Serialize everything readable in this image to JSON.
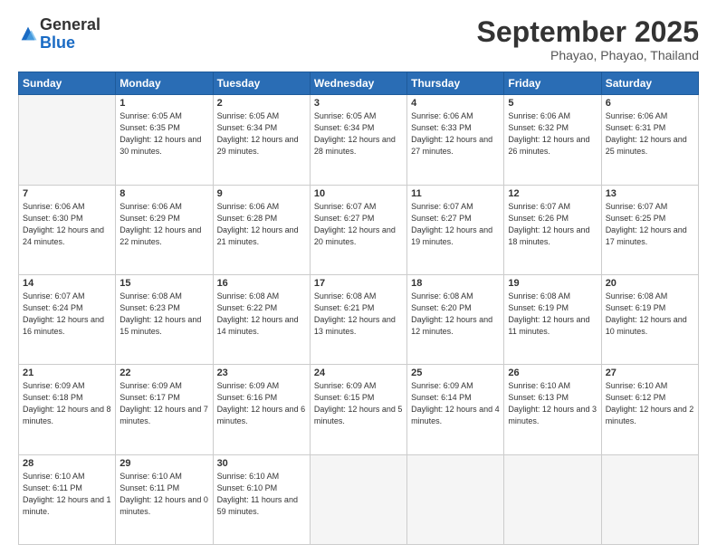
{
  "header": {
    "logo_general": "General",
    "logo_blue": "Blue",
    "month_title": "September 2025",
    "subtitle": "Phayao, Phayao, Thailand"
  },
  "days_of_week": [
    "Sunday",
    "Monday",
    "Tuesday",
    "Wednesday",
    "Thursday",
    "Friday",
    "Saturday"
  ],
  "weeks": [
    [
      {
        "day": "",
        "empty": true
      },
      {
        "day": "1",
        "sunrise": "6:05 AM",
        "sunset": "6:35 PM",
        "daylight": "12 hours and 30 minutes."
      },
      {
        "day": "2",
        "sunrise": "6:05 AM",
        "sunset": "6:34 PM",
        "daylight": "12 hours and 29 minutes."
      },
      {
        "day": "3",
        "sunrise": "6:05 AM",
        "sunset": "6:34 PM",
        "daylight": "12 hours and 28 minutes."
      },
      {
        "day": "4",
        "sunrise": "6:06 AM",
        "sunset": "6:33 PM",
        "daylight": "12 hours and 27 minutes."
      },
      {
        "day": "5",
        "sunrise": "6:06 AM",
        "sunset": "6:32 PM",
        "daylight": "12 hours and 26 minutes."
      },
      {
        "day": "6",
        "sunrise": "6:06 AM",
        "sunset": "6:31 PM",
        "daylight": "12 hours and 25 minutes."
      }
    ],
    [
      {
        "day": "7",
        "sunrise": "6:06 AM",
        "sunset": "6:30 PM",
        "daylight": "12 hours and 24 minutes."
      },
      {
        "day": "8",
        "sunrise": "6:06 AM",
        "sunset": "6:29 PM",
        "daylight": "12 hours and 22 minutes."
      },
      {
        "day": "9",
        "sunrise": "6:06 AM",
        "sunset": "6:28 PM",
        "daylight": "12 hours and 21 minutes."
      },
      {
        "day": "10",
        "sunrise": "6:07 AM",
        "sunset": "6:27 PM",
        "daylight": "12 hours and 20 minutes."
      },
      {
        "day": "11",
        "sunrise": "6:07 AM",
        "sunset": "6:27 PM",
        "daylight": "12 hours and 19 minutes."
      },
      {
        "day": "12",
        "sunrise": "6:07 AM",
        "sunset": "6:26 PM",
        "daylight": "12 hours and 18 minutes."
      },
      {
        "day": "13",
        "sunrise": "6:07 AM",
        "sunset": "6:25 PM",
        "daylight": "12 hours and 17 minutes."
      }
    ],
    [
      {
        "day": "14",
        "sunrise": "6:07 AM",
        "sunset": "6:24 PM",
        "daylight": "12 hours and 16 minutes."
      },
      {
        "day": "15",
        "sunrise": "6:08 AM",
        "sunset": "6:23 PM",
        "daylight": "12 hours and 15 minutes."
      },
      {
        "day": "16",
        "sunrise": "6:08 AM",
        "sunset": "6:22 PM",
        "daylight": "12 hours and 14 minutes."
      },
      {
        "day": "17",
        "sunrise": "6:08 AM",
        "sunset": "6:21 PM",
        "daylight": "12 hours and 13 minutes."
      },
      {
        "day": "18",
        "sunrise": "6:08 AM",
        "sunset": "6:20 PM",
        "daylight": "12 hours and 12 minutes."
      },
      {
        "day": "19",
        "sunrise": "6:08 AM",
        "sunset": "6:19 PM",
        "daylight": "12 hours and 11 minutes."
      },
      {
        "day": "20",
        "sunrise": "6:08 AM",
        "sunset": "6:19 PM",
        "daylight": "12 hours and 10 minutes."
      }
    ],
    [
      {
        "day": "21",
        "sunrise": "6:09 AM",
        "sunset": "6:18 PM",
        "daylight": "12 hours and 8 minutes."
      },
      {
        "day": "22",
        "sunrise": "6:09 AM",
        "sunset": "6:17 PM",
        "daylight": "12 hours and 7 minutes."
      },
      {
        "day": "23",
        "sunrise": "6:09 AM",
        "sunset": "6:16 PM",
        "daylight": "12 hours and 6 minutes."
      },
      {
        "day": "24",
        "sunrise": "6:09 AM",
        "sunset": "6:15 PM",
        "daylight": "12 hours and 5 minutes."
      },
      {
        "day": "25",
        "sunrise": "6:09 AM",
        "sunset": "6:14 PM",
        "daylight": "12 hours and 4 minutes."
      },
      {
        "day": "26",
        "sunrise": "6:10 AM",
        "sunset": "6:13 PM",
        "daylight": "12 hours and 3 minutes."
      },
      {
        "day": "27",
        "sunrise": "6:10 AM",
        "sunset": "6:12 PM",
        "daylight": "12 hours and 2 minutes."
      }
    ],
    [
      {
        "day": "28",
        "sunrise": "6:10 AM",
        "sunset": "6:11 PM",
        "daylight": "12 hours and 1 minute."
      },
      {
        "day": "29",
        "sunrise": "6:10 AM",
        "sunset": "6:11 PM",
        "daylight": "12 hours and 0 minutes."
      },
      {
        "day": "30",
        "sunrise": "6:10 AM",
        "sunset": "6:10 PM",
        "daylight": "11 hours and 59 minutes."
      },
      {
        "day": "",
        "empty": true
      },
      {
        "day": "",
        "empty": true
      },
      {
        "day": "",
        "empty": true
      },
      {
        "day": "",
        "empty": true
      }
    ]
  ]
}
